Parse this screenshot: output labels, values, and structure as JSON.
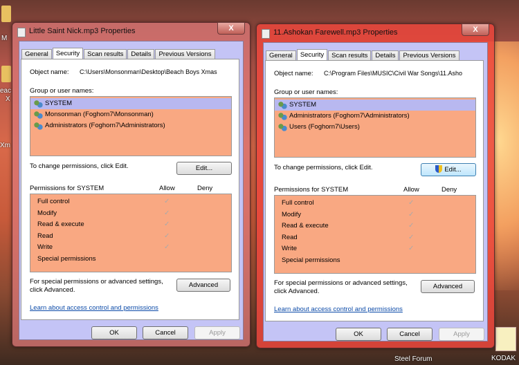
{
  "desktop": {
    "icons": [
      {
        "label": "M"
      },
      {
        "label": "eac"
      },
      {
        "label": "X"
      },
      {
        "label": "Xm"
      },
      {
        "label": "Steel Forum"
      },
      {
        "label": "KODAK"
      }
    ]
  },
  "labels": {
    "object_name": "Object name:",
    "group": "Group or user names:",
    "change": "To change permissions, click Edit.",
    "edit": "Edit...",
    "allow": "Allow",
    "deny": "Deny",
    "special1": "For special permissions or advanced settings,",
    "special2": "click Advanced.",
    "advanced": "Advanced",
    "link": "Learn about access control and permissions",
    "ok": "OK",
    "cancel": "Cancel",
    "apply": "Apply",
    "close": "X"
  },
  "tabs": [
    "General",
    "Security",
    "Scan results",
    "Details",
    "Previous Versions"
  ],
  "permissions": [
    "Full control",
    "Modify",
    "Read & execute",
    "Read",
    "Write",
    "Special permissions"
  ],
  "allow_checked": [
    true,
    true,
    true,
    true,
    true,
    false
  ],
  "dialogs": [
    {
      "title": "Little Saint Nick.mp3 Properties",
      "object_path": "C:\\Users\\Monsonman\\Desktop\\Beach Boys Xmas",
      "users": [
        "SYSTEM",
        "Monsonman (Foghorn7\\Monsonman)",
        "Administrators (Foghorn7\\Administrators)"
      ],
      "selected_user": "SYSTEM",
      "perm_header": "Permissions for SYSTEM",
      "active": false
    },
    {
      "title": "11.Ashokan Farewell.mp3 Properties",
      "object_path": "C:\\Program Files\\MUSIC\\Civil War Songs\\11.Asho",
      "users": [
        "SYSTEM",
        "Administrators (Foghorn7\\Administrators)",
        "Users (Foghorn7\\Users)"
      ],
      "selected_user": "SYSTEM",
      "perm_header": "Permissions for SYSTEM",
      "active": true
    }
  ],
  "colors": {
    "list_bg": "#f9a882",
    "selected": "#b8b8f0",
    "frame": "#c4c4f6"
  }
}
